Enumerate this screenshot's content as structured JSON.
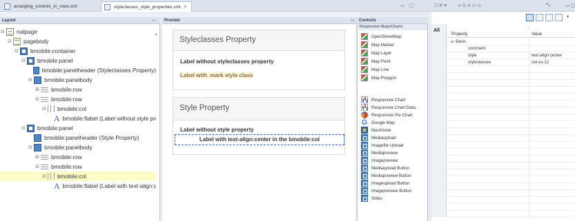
{
  "editor_tabs": [
    {
      "label": "arranging_controls_in_rows.xml",
      "active": false
    },
    {
      "label": "styleclasses_style_properties.xml",
      "active": true
    }
  ],
  "layout": {
    "title": "Layout",
    "tree": [
      {
        "label": "natpage",
        "icon": "page",
        "toggle": "⊟"
      },
      {
        "label": "pagebody",
        "icon": "body",
        "toggle": "⊟"
      },
      {
        "label": "bmobile:container",
        "icon": "container",
        "toggle": "⊟"
      },
      {
        "label": "bmobile:panel",
        "icon": "panel",
        "toggle": "⊟"
      },
      {
        "label": "bmobile:panelheader (Styleclasses Property)",
        "icon": "panelheader",
        "toggle": ""
      },
      {
        "label": "bmobile:panelbody",
        "icon": "panelbody",
        "toggle": "⊟"
      },
      {
        "label": "bmobile:row",
        "icon": "row",
        "toggle": "⊞"
      },
      {
        "label": "bmobile:row",
        "icon": "row",
        "toggle": "⊟"
      },
      {
        "label": "bmobile:col",
        "icon": "col",
        "toggle": "⊟"
      },
      {
        "label": "bmobile:flabel (Label without style property)",
        "icon": "label",
        "toggle": ""
      },
      {
        "label": "bmobile:panel",
        "icon": "panel",
        "toggle": "⊟"
      },
      {
        "label": "bmobile:panelheader (Style Property)",
        "icon": "panelheader",
        "toggle": ""
      },
      {
        "label": "bmobile:panelbody",
        "icon": "panelbody",
        "toggle": "⊟"
      },
      {
        "label": "bmobile:row",
        "icon": "row",
        "toggle": "⊞"
      },
      {
        "label": "bmobile:row",
        "icon": "row",
        "toggle": "⊟"
      },
      {
        "label": "bmobile:col",
        "icon": "col",
        "toggle": "⊟",
        "selected": true
      },
      {
        "label": "bmobile:flabel (Label with text-align:center in the bmobile:col)",
        "icon": "label",
        "toggle": ""
      }
    ]
  },
  "preview": {
    "title": "Preview",
    "panel1": {
      "title": "Styleclasses Property",
      "label1": "Label without styleclasses property",
      "label2": "Label with .mark style class"
    },
    "panel2": {
      "title": "Style Property",
      "label1": "Label without style property",
      "label2": "Label with text-align:center in the bmobile:col"
    }
  },
  "controls": {
    "title": "Controls",
    "group": "Responsive Maps/Charts",
    "items": [
      {
        "label": "OpenStreetMap",
        "icon": "map"
      },
      {
        "label": "Map Marker",
        "icon": "map"
      },
      {
        "label": "Map Layer",
        "icon": "map"
      },
      {
        "label": "Map Point",
        "icon": "map"
      },
      {
        "label": "Map Line",
        "icon": "map"
      },
      {
        "label": "Map Polygon",
        "icon": "map"
      },
      {
        "label": "Responsive Chart",
        "icon": "chart"
      },
      {
        "label": "Responsive Chart Data",
        "icon": "chart"
      },
      {
        "label": "Responsive Pie Chart",
        "icon": "pie"
      },
      {
        "label": "Google Map",
        "icon": "google"
      },
      {
        "label": "Mashzone",
        "icon": "mashzone"
      },
      {
        "label": "Mediaupload",
        "icon": "blue"
      },
      {
        "label": "Imagefile Upload",
        "icon": "blue"
      },
      {
        "label": "Mediapreview",
        "icon": "blue"
      },
      {
        "label": "Imagepreview",
        "icon": "blue"
      },
      {
        "label": "Mediaupload Button",
        "icon": "blue"
      },
      {
        "label": "Mediapreview Button",
        "icon": "blue"
      },
      {
        "label": "Imageupload Button",
        "icon": "blue"
      },
      {
        "label": "Imagepreview Button",
        "icon": "blue"
      },
      {
        "label": "Video",
        "icon": "blue"
      }
    ]
  },
  "properties": {
    "tab_label": "P",
    "all_tab": "All",
    "col_property": "Property",
    "col_value": "Value",
    "section": "Basic",
    "rows": [
      {
        "key": "comment",
        "value": ""
      },
      {
        "key": "style",
        "value": "text-align:center"
      },
      {
        "key": "styleclasses",
        "value": "col-xs-12"
      }
    ]
  }
}
